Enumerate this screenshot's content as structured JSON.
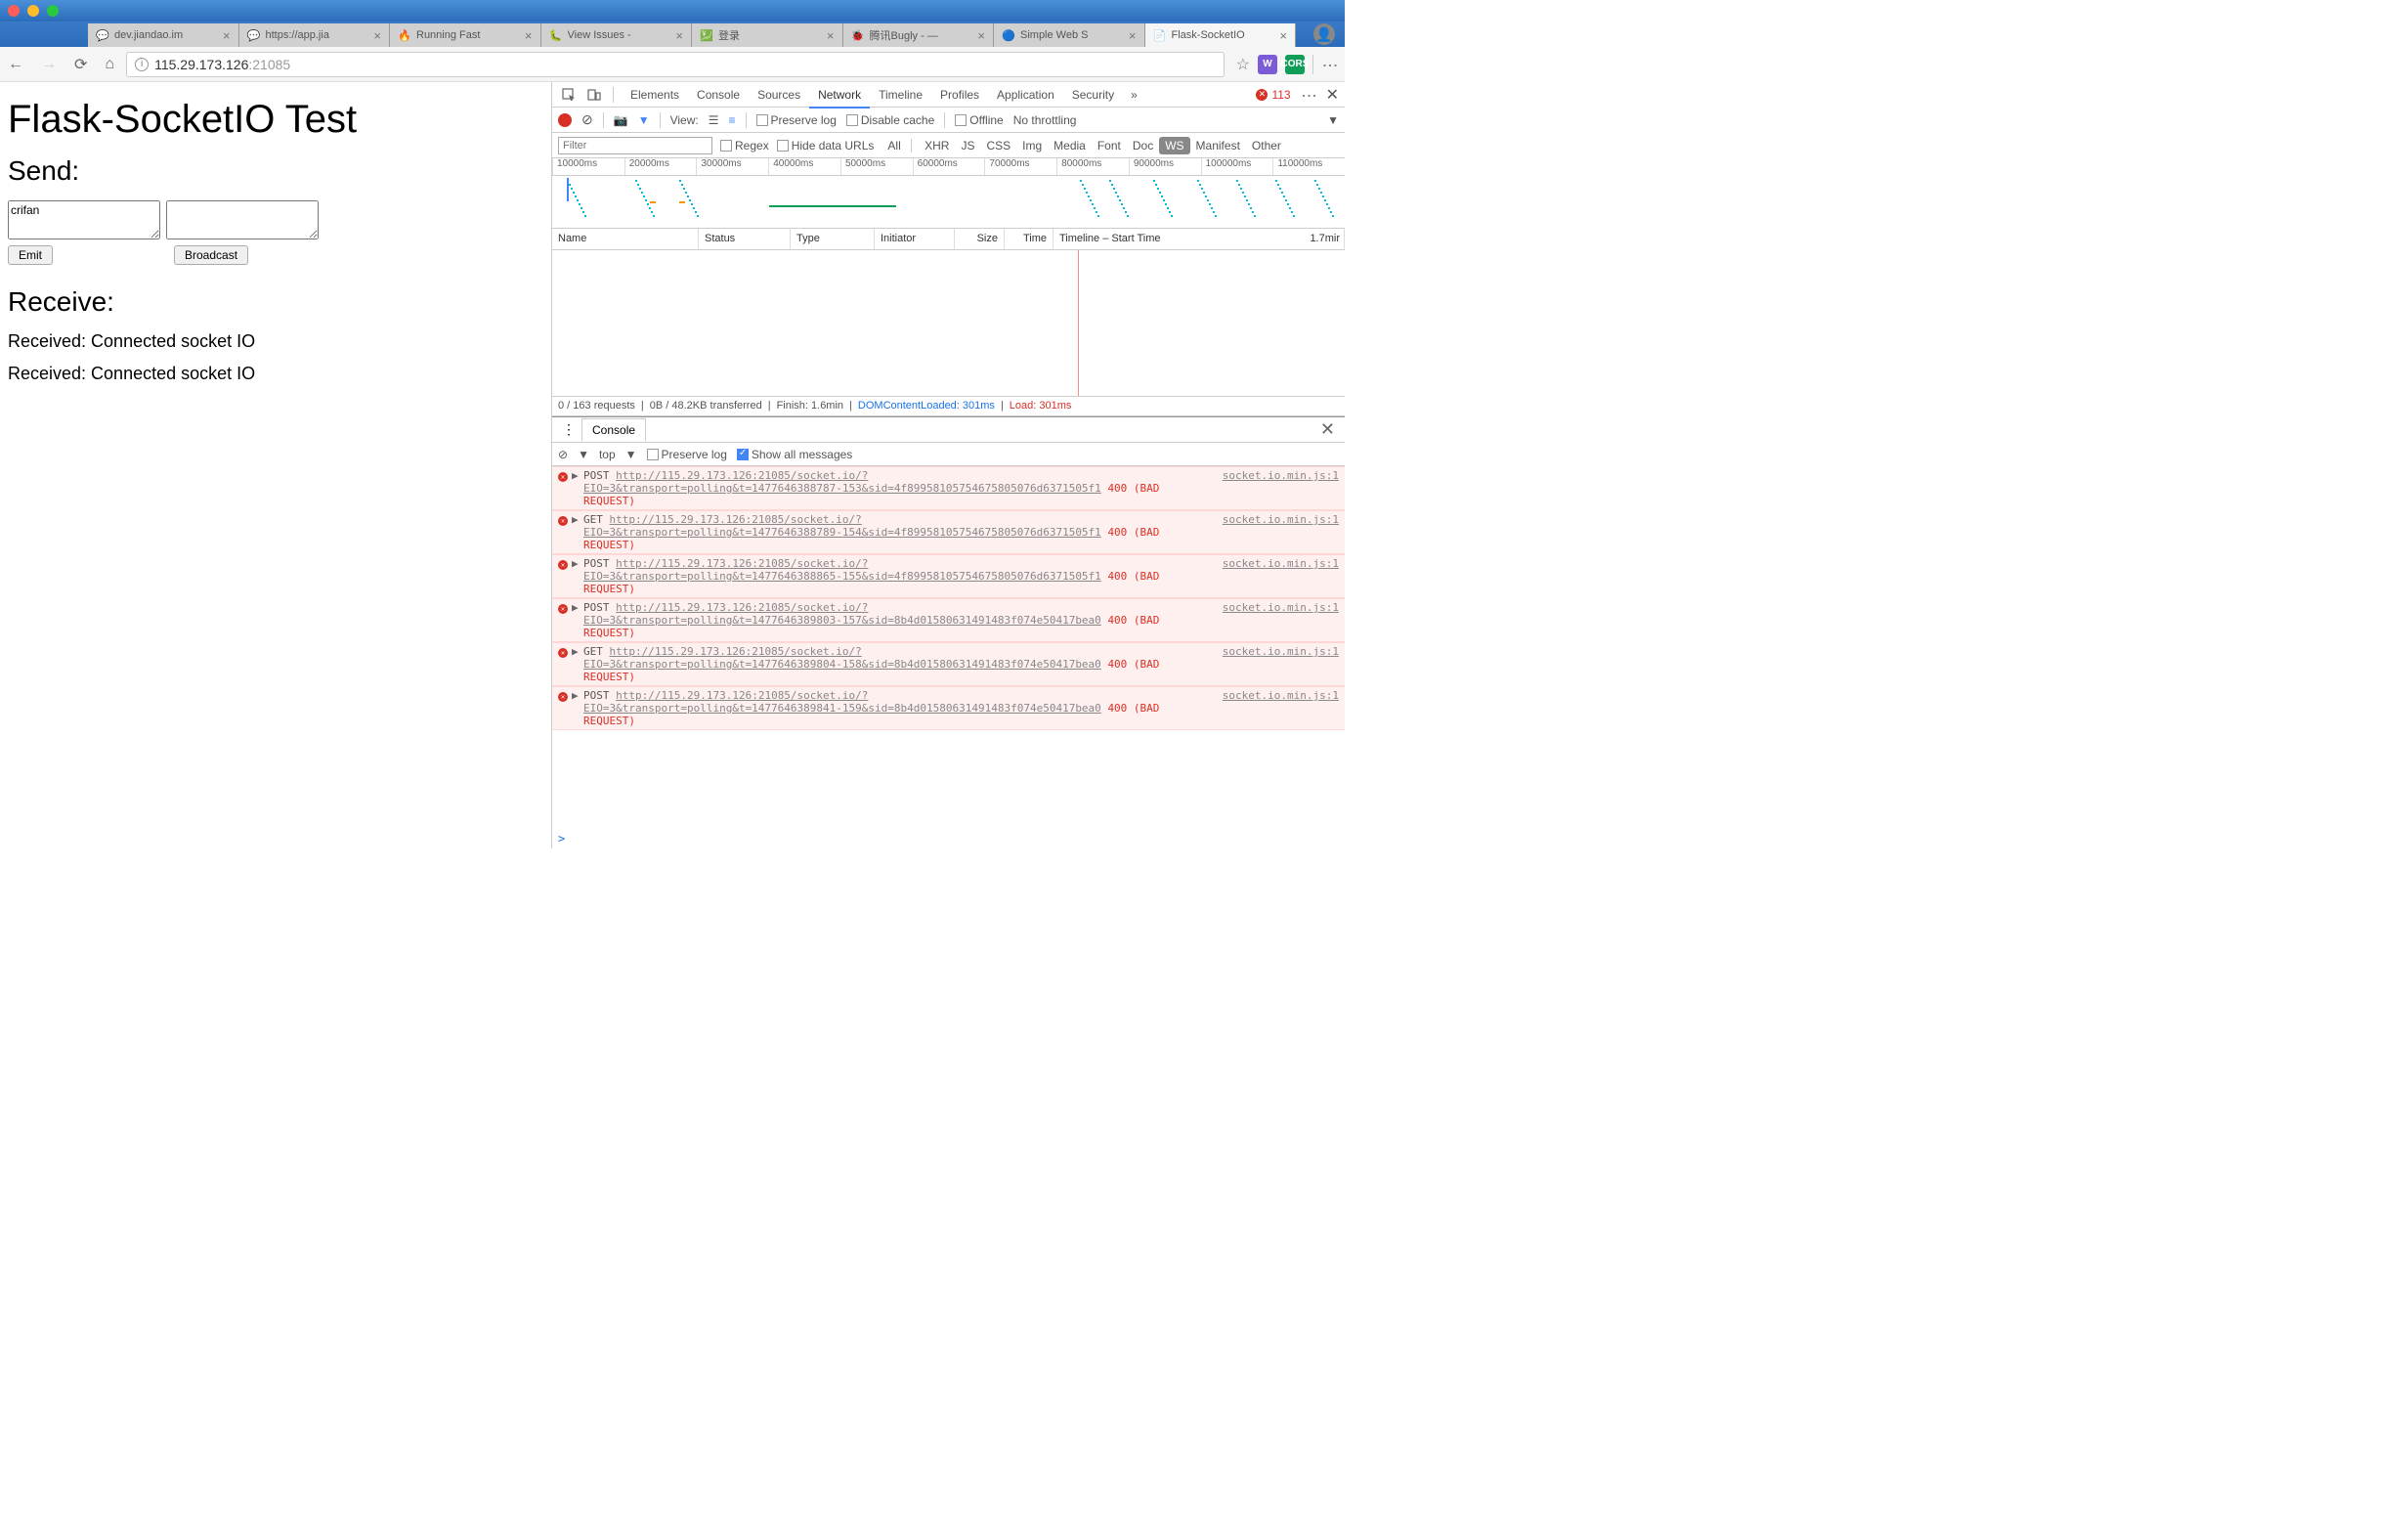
{
  "browser": {
    "tabs": [
      {
        "favicon": "💬",
        "title": "dev.jiandao.im"
      },
      {
        "favicon": "💬",
        "title": "https://app.jia"
      },
      {
        "favicon": "🔥",
        "title": "Running Fast"
      },
      {
        "favicon": "🐛",
        "title": "View Issues -"
      },
      {
        "favicon": "💹",
        "title": "登录"
      },
      {
        "favicon": "🐞",
        "title": "腾讯Bugly - —"
      },
      {
        "favicon": "🔵",
        "title": "Simple Web S"
      },
      {
        "favicon": "📄",
        "title": "Flask-SocketIO",
        "active": true
      }
    ],
    "url_host": "115.29.173.126",
    "url_port": ":21085"
  },
  "page": {
    "title": "Flask-SocketIO Test",
    "send_heading": "Send:",
    "input1_value": "crifan",
    "input2_value": "",
    "emit_btn": "Emit",
    "broadcast_btn": "Broadcast",
    "receive_heading": "Receive:",
    "received_lines": [
      "Received: Connected socket IO",
      "Received: Connected socket IO"
    ]
  },
  "devtools": {
    "tabs": [
      "Elements",
      "Console",
      "Sources",
      "Network",
      "Timeline",
      "Profiles",
      "Application",
      "Security"
    ],
    "active_tab": "Network",
    "error_count": "113",
    "net_toolbar": {
      "view_label": "View:",
      "preserve": "Preserve log",
      "disable_cache": "Disable cache",
      "offline": "Offline",
      "throttling": "No throttling"
    },
    "filter": {
      "placeholder": "Filter",
      "regex": "Regex",
      "hide_urls": "Hide data URLs",
      "types": [
        "All",
        "XHR",
        "JS",
        "CSS",
        "Img",
        "Media",
        "Font",
        "Doc",
        "WS",
        "Manifest",
        "Other"
      ],
      "active_type": "WS"
    },
    "timeline_marks": [
      "10000ms",
      "20000ms",
      "30000ms",
      "40000ms",
      "50000ms",
      "60000ms",
      "70000ms",
      "80000ms",
      "90000ms",
      "100000ms",
      "110000ms"
    ],
    "net_cols": {
      "name": "Name",
      "status": "Status",
      "type": "Type",
      "initiator": "Initiator",
      "size": "Size",
      "time": "Time",
      "timeline": "Timeline – Start Time",
      "end": "1.7mir"
    },
    "net_status": {
      "requests": "0 / 163 requests",
      "transferred": "0B / 48.2KB transferred",
      "finish": "Finish: 1.6min",
      "dcl": "DOMContentLoaded: 301ms",
      "load": "Load: 301ms"
    },
    "console": {
      "tab_label": "Console",
      "top": "top",
      "preserve": "Preserve log",
      "show_all": "Show all messages",
      "prompt": ">",
      "source": "socket.io.min.js:1",
      "entries": [
        {
          "method": "POST",
          "url": "http://115.29.173.126:21085/socket.io/?",
          "query": "EIO=3&transport=polling&t=1477646388787-153&sid=4f89958105754675805076d6371505f1",
          "status": "400 (BAD REQUEST)"
        },
        {
          "method": "GET",
          "url": "http://115.29.173.126:21085/socket.io/?",
          "query": "EIO=3&transport=polling&t=1477646388789-154&sid=4f89958105754675805076d6371505f1",
          "status": "400 (BAD REQUEST)"
        },
        {
          "method": "POST",
          "url": "http://115.29.173.126:21085/socket.io/?",
          "query": "EIO=3&transport=polling&t=1477646388865-155&sid=4f89958105754675805076d6371505f1",
          "status": "400 (BAD REQUEST)"
        },
        {
          "method": "POST",
          "url": "http://115.29.173.126:21085/socket.io/?",
          "query": "EIO=3&transport=polling&t=1477646389803-157&sid=8b4d01580631491483f074e50417bea0",
          "status": "400 (BAD REQUEST)"
        },
        {
          "method": "GET",
          "url": "http://115.29.173.126:21085/socket.io/?",
          "query": "EIO=3&transport=polling&t=1477646389804-158&sid=8b4d01580631491483f074e50417bea0",
          "status": "400 (BAD REQUEST)"
        },
        {
          "method": "POST",
          "url": "http://115.29.173.126:21085/socket.io/?",
          "query": "EIO=3&transport=polling&t=1477646389841-159&sid=8b4d01580631491483f074e50417bea0",
          "status": "400 (BAD REQUEST)"
        }
      ]
    }
  }
}
